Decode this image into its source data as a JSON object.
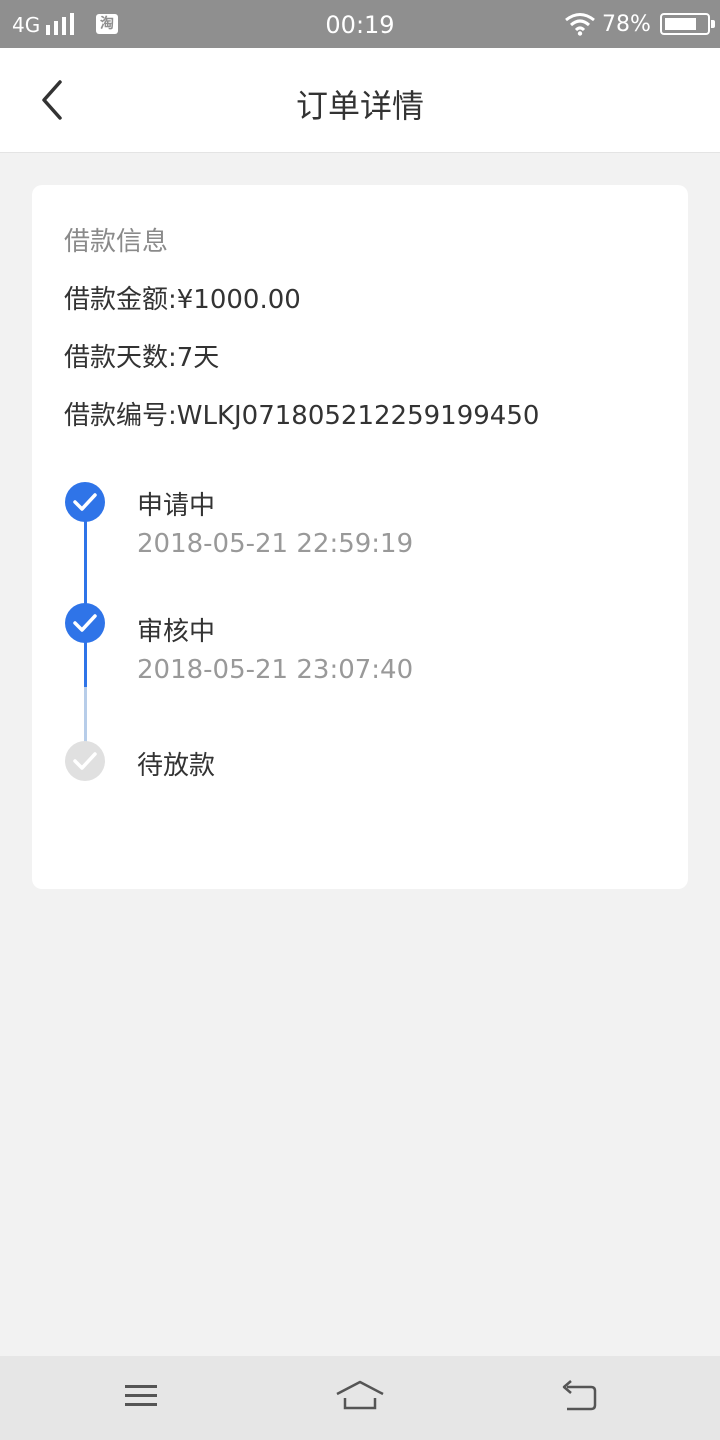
{
  "status_bar": {
    "network": "4G",
    "app_icon_text": "淘",
    "time": "00:19",
    "battery_percent": "78%",
    "battery_level": 0.78,
    "icons": [
      "signal-icon",
      "taobao-icon",
      "wifi-icon",
      "battery-icon"
    ]
  },
  "nav": {
    "title": "订单详情",
    "back_icon": "back-arrow-icon"
  },
  "loan_info": {
    "section_title": "借款信息",
    "amount_label": "借款金额:",
    "amount_value": "¥1000.00",
    "days_label": "借款天数:",
    "days_value": "7天",
    "number_label": "借款编号:",
    "number_value": "WLKJ071805212259199450"
  },
  "progress": {
    "steps": [
      {
        "name": "申请中",
        "time": "2018-05-21 22:59:19",
        "completed": true
      },
      {
        "name": "审核中",
        "time": "2018-05-21 23:07:40",
        "completed": true
      },
      {
        "name": "待放款",
        "time": "",
        "completed": false
      }
    ],
    "colors": {
      "done": "#2f74e8",
      "pending": "#e0e0e0",
      "pending_line": "#b7cde9"
    }
  },
  "system_nav": {
    "icons": [
      "menu-icon",
      "home-icon",
      "return-icon"
    ]
  }
}
